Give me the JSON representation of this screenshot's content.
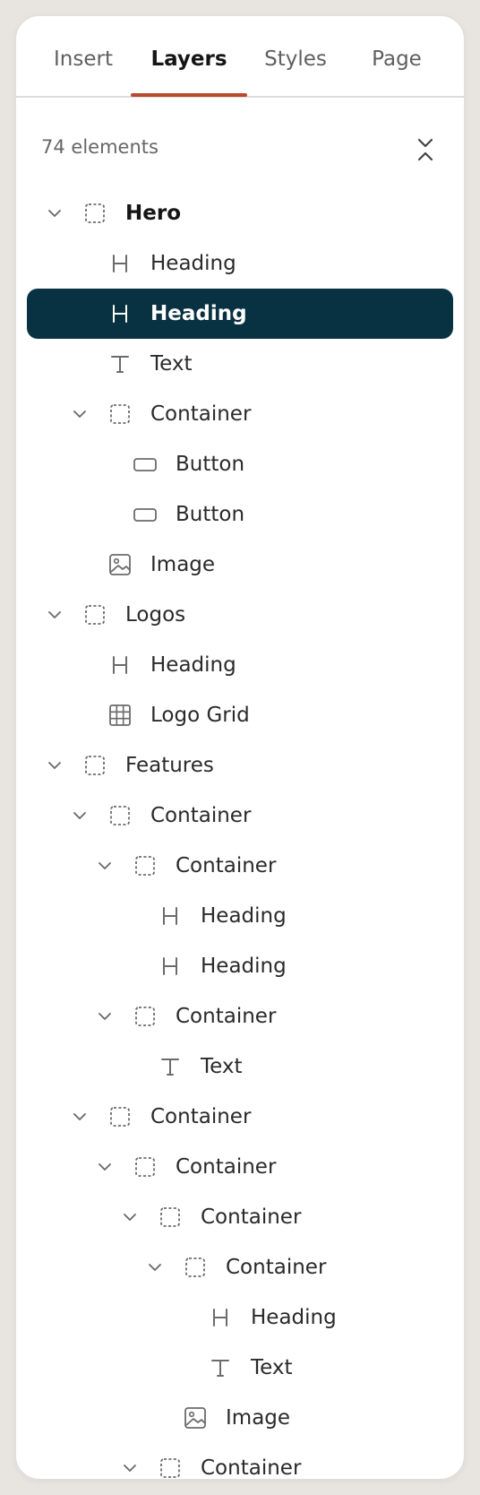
{
  "tabs": [
    {
      "label": "Insert",
      "active": false
    },
    {
      "label": "Layers",
      "active": true
    },
    {
      "label": "Styles",
      "active": false
    },
    {
      "label": "Page",
      "active": false
    }
  ],
  "layers": {
    "count_label": "74 elements",
    "items": [
      {
        "label": "Hero",
        "type": "container",
        "depth": 0,
        "expanded": true,
        "bold": true
      },
      {
        "label": "Heading",
        "type": "heading",
        "depth": 1
      },
      {
        "label": "Heading",
        "type": "heading",
        "depth": 1,
        "selected": true
      },
      {
        "label": "Text",
        "type": "text",
        "depth": 1
      },
      {
        "label": "Container",
        "type": "container",
        "depth": 1,
        "expanded": true
      },
      {
        "label": "Button",
        "type": "button",
        "depth": 2
      },
      {
        "label": "Button",
        "type": "button",
        "depth": 2
      },
      {
        "label": "Image",
        "type": "image",
        "depth": 1
      },
      {
        "label": "Logos",
        "type": "container",
        "depth": 0,
        "expanded": true
      },
      {
        "label": "Heading",
        "type": "heading",
        "depth": 1
      },
      {
        "label": "Logo Grid",
        "type": "grid",
        "depth": 1
      },
      {
        "label": "Features",
        "type": "container",
        "depth": 0,
        "expanded": true
      },
      {
        "label": "Container",
        "type": "container",
        "depth": 1,
        "expanded": true
      },
      {
        "label": "Container",
        "type": "container",
        "depth": 2,
        "expanded": true
      },
      {
        "label": "Heading",
        "type": "heading",
        "depth": 3
      },
      {
        "label": "Heading",
        "type": "heading",
        "depth": 3
      },
      {
        "label": "Container",
        "type": "container",
        "depth": 2,
        "expanded": true
      },
      {
        "label": "Text",
        "type": "text",
        "depth": 3
      },
      {
        "label": "Container",
        "type": "container",
        "depth": 1,
        "expanded": true
      },
      {
        "label": "Container",
        "type": "container",
        "depth": 2,
        "expanded": true
      },
      {
        "label": "Container",
        "type": "container",
        "depth": 3,
        "expanded": true
      },
      {
        "label": "Container",
        "type": "container",
        "depth": 4,
        "expanded": true
      },
      {
        "label": "Heading",
        "type": "heading",
        "depth": 5
      },
      {
        "label": "Text",
        "type": "text",
        "depth": 5
      },
      {
        "label": "Image",
        "type": "image",
        "depth": 4
      },
      {
        "label": "Container",
        "type": "container",
        "depth": 3,
        "expanded": true
      }
    ]
  },
  "colors": {
    "accent": "#b8492c",
    "selected_bg": "#083241",
    "icon": "#6b6b6b",
    "selected_icon": "#ffffff"
  },
  "icons": {
    "collapse": "collapse-all-icon",
    "chevron": "chevron-down-icon",
    "container": "dashed-square-icon",
    "heading": "heading-h-icon",
    "text": "text-t-icon",
    "button": "button-rect-icon",
    "image": "image-icon",
    "grid": "grid-icon"
  }
}
